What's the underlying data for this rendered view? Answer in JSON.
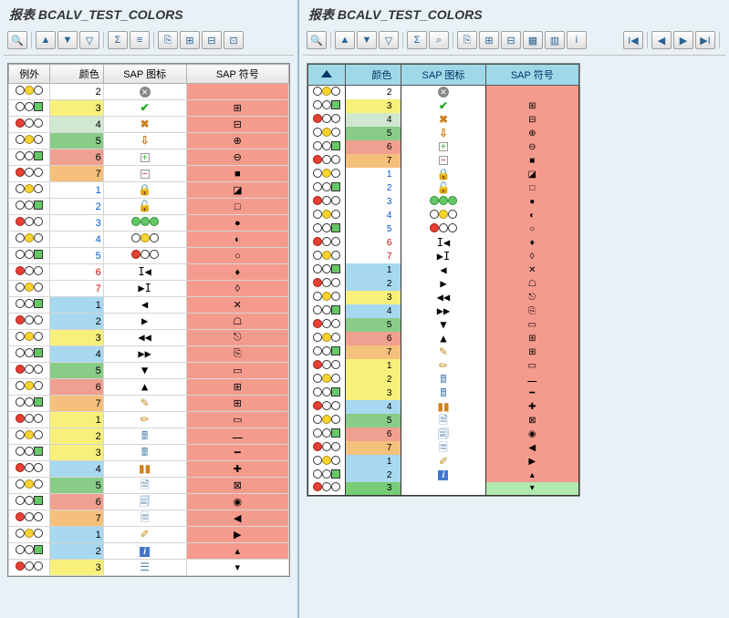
{
  "left": {
    "title": "报表 BCALV_TEST_COLORS",
    "toolbar": [
      {
        "name": "details",
        "glyph": "🔍"
      },
      {
        "name": "sort-asc",
        "glyph": "▲"
      },
      {
        "name": "sort-desc",
        "glyph": "▼"
      },
      {
        "name": "filter",
        "glyph": "▽"
      },
      {
        "name": "sum",
        "glyph": "Σ"
      },
      {
        "name": "subtotal",
        "glyph": "≡"
      },
      {
        "name": "export",
        "glyph": "⎘"
      },
      {
        "name": "excel",
        "glyph": "⊞"
      },
      {
        "name": "layout",
        "glyph": "⊟"
      },
      {
        "name": "save-variant",
        "glyph": "⊡"
      }
    ],
    "headers": {
      "ex": "例外",
      "color": "颜色",
      "icon": "SAP 图标",
      "symbol": "SAP 符号"
    }
  },
  "right": {
    "title": "报表 BCALV_TEST_COLORS",
    "toolbar_main": [
      {
        "name": "details",
        "glyph": "🔍"
      },
      {
        "name": "sort-asc",
        "glyph": "▲"
      },
      {
        "name": "sort-desc",
        "glyph": "▼"
      },
      {
        "name": "filter",
        "glyph": "▽"
      },
      {
        "name": "sum",
        "glyph": "Σ"
      },
      {
        "name": "find",
        "glyph": "⌕"
      },
      {
        "name": "export",
        "glyph": "⎘"
      },
      {
        "name": "excel",
        "glyph": "⊞"
      },
      {
        "name": "layout",
        "glyph": "⊟"
      },
      {
        "name": "grid",
        "glyph": "▦"
      },
      {
        "name": "grid2",
        "glyph": "▥"
      },
      {
        "name": "info",
        "glyph": "i"
      }
    ],
    "toolbar_nav": [
      {
        "name": "first",
        "glyph": "I◀"
      },
      {
        "name": "prev",
        "glyph": "◀"
      },
      {
        "name": "next",
        "glyph": "▶"
      },
      {
        "name": "last",
        "glyph": "▶I"
      }
    ],
    "headers": {
      "ex": "△",
      "color": "颜色",
      "icon": "SAP 图标",
      "symbol": "SAP 符号"
    }
  },
  "rows": [
    {
      "tl": "wyw",
      "cl": "2",
      "cbg": "def",
      "icon": "x",
      "sym": ""
    },
    {
      "tl": "wwG",
      "cl": "3",
      "cbg": "3",
      "icon": "ck",
      "sym": "⊞"
    },
    {
      "tl": "Rww",
      "cl": "4",
      "cbg": "2",
      "icon": "xx",
      "sym": "⊟"
    },
    {
      "tl": "wyw",
      "cl": "5",
      "cbg": "4",
      "icon": "dn",
      "sym": "⊕"
    },
    {
      "tl": "wwG",
      "cl": "6",
      "cbg": "6",
      "icon": "pl",
      "sym": "⊖"
    },
    {
      "tl": "Rww",
      "cl": "7",
      "cbg": "7",
      "icon": "mn",
      "sym": "■"
    },
    {
      "tl": "wyw",
      "cl": "1",
      "cbg": "def",
      "txt": "blue",
      "icon": "lk",
      "sym": "◪"
    },
    {
      "tl": "wwG",
      "cl": "2",
      "cbg": "def",
      "txt": "blue",
      "icon": "ul",
      "sym": "□"
    },
    {
      "tl": "Rww",
      "cl": "3",
      "cbg": "def",
      "txt": "blue",
      "icon": "lt-ggg",
      "sym": "●"
    },
    {
      "tl": "wyw",
      "cl": "4",
      "cbg": "def",
      "txt": "blue",
      "icon": "lt-ywy",
      "sym": "◐"
    },
    {
      "tl": "wwG",
      "cl": "5",
      "cbg": "def",
      "txt": "blue",
      "icon": "lt-rww",
      "sym": "○"
    },
    {
      "tl": "Rww",
      "cl": "6",
      "cbg": "def",
      "txt": "red",
      "icon": "nav-first",
      "sym": "♦"
    },
    {
      "tl": "wyw",
      "cl": "7",
      "cbg": "def",
      "txt": "red",
      "icon": "nav-last",
      "sym": "◊"
    },
    {
      "tl": "wwG",
      "cl": "1",
      "cbg": "1",
      "icon": "nav-left",
      "sym": "✕"
    },
    {
      "tl": "Rww",
      "cl": "2",
      "cbg": "1",
      "icon": "nav-right",
      "sym": "☖"
    },
    {
      "tl": "wyw",
      "cl": "3",
      "cbg": "3",
      "icon": "nav-dleft",
      "sym": "⎋"
    },
    {
      "tl": "wwG",
      "cl": "4",
      "cbg": "1",
      "icon": "nav-dright",
      "sym": "⎘"
    },
    {
      "tl": "Rww",
      "cl": "5",
      "cbg": "4",
      "icon": "tri-dn",
      "sym": "▭"
    },
    {
      "tl": "wyw",
      "cl": "6",
      "cbg": "6",
      "icon": "tri-up",
      "sym": "⊞"
    },
    {
      "tl": "wwG",
      "cl": "7",
      "cbg": "7",
      "icon": "pen",
      "sym": "⊞"
    },
    {
      "tl": "Rww",
      "cl": "1",
      "cbg": "3",
      "icon": "pen2",
      "sym": "▭"
    },
    {
      "tl": "wyw",
      "cl": "2",
      "cbg": "3",
      "icon": "calc",
      "sym": "⎼"
    },
    {
      "tl": "wwG",
      "cl": "3",
      "cbg": "3",
      "icon": "calc2",
      "sym": "━"
    },
    {
      "tl": "Rww",
      "cl": "4",
      "cbg": "1",
      "icon": "bar",
      "sym": "✚"
    },
    {
      "tl": "wyw",
      "cl": "5",
      "cbg": "4",
      "icon": "doc",
      "sym": "⊠"
    },
    {
      "tl": "wwG",
      "cl": "6",
      "cbg": "6",
      "icon": "doc2",
      "sym": "◉"
    },
    {
      "tl": "Rww",
      "cl": "7",
      "cbg": "7",
      "icon": "doc3",
      "sym": "◀"
    },
    {
      "tl": "wyw",
      "cl": "1",
      "cbg": "1",
      "icon": "pen3",
      "sym": "▶"
    },
    {
      "tl": "wwG",
      "cl": "2",
      "cbg": "1",
      "icon": "info",
      "sym": "▴"
    },
    {
      "tl": "Rww",
      "cl": "3",
      "cbg": "3",
      "icon": "list",
      "sym": "▾",
      "symcls": "white"
    }
  ],
  "right_extra_last": {
    "tl": "Rww",
    "cl": "3",
    "cbg": "5",
    "icon": "",
    "sym": "▾",
    "symcls": "green"
  }
}
